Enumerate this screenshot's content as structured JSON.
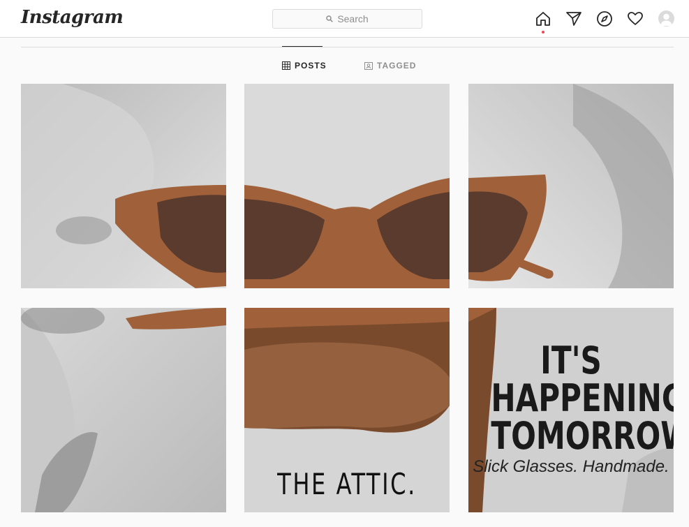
{
  "app": {
    "logo": "Instagram"
  },
  "search": {
    "placeholder": "Search"
  },
  "nav": {
    "icons": [
      "home-icon",
      "direct-icon",
      "explore-icon",
      "activity-icon",
      "profile-avatar"
    ]
  },
  "tabs": [
    {
      "label": "POSTS",
      "active": true
    },
    {
      "label": "TAGGED",
      "active": false
    }
  ],
  "posts": {
    "tile5_text": "THE ATTIC.",
    "tile6_line1": "IT'S",
    "tile6_line2": "HAPPENING",
    "tile6_line3": "TOMORROW",
    "tile6_sub": "Slick Glasses. Handmade."
  },
  "colors": {
    "accent": "#ed4956",
    "text": "#262626",
    "muted": "#8e8e8e",
    "border": "#dbdbdb",
    "wood": "#a0613a"
  }
}
